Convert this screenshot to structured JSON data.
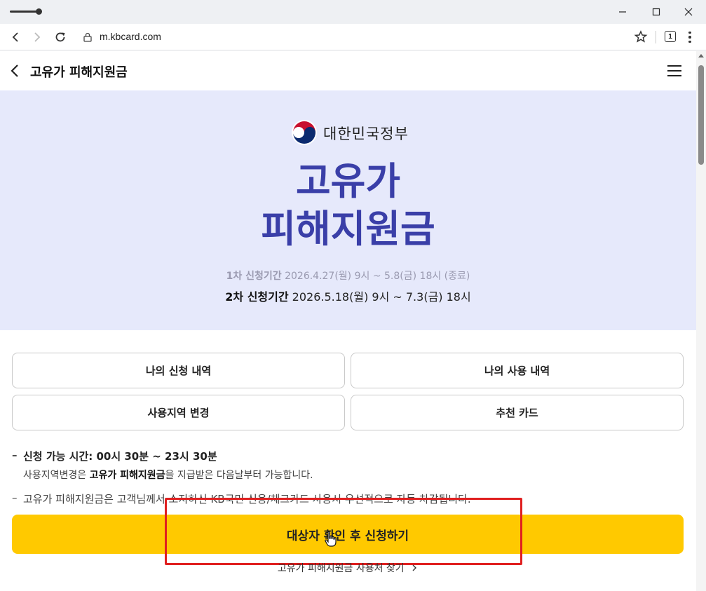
{
  "browser": {
    "url": "m.kbcard.com",
    "tab_count": "1"
  },
  "header": {
    "title": "고유가 피해지원금"
  },
  "hero": {
    "gov_name": "대한민국정부",
    "title_line1": "고유가",
    "title_line2": "피해지원금",
    "period1_label": "1차 신청기간",
    "period1_value": " 2026.4.27(월) 9시 ~ 5.8(금) 18시 (종료)",
    "period2_label": "2차 신청기간",
    "period2_value": " 2026.5.18(월) 9시 ~ 7.3(금) 18시"
  },
  "buttons": {
    "my_application": "나의 신청 내역",
    "my_usage": "나의 사용 내역",
    "change_region": "사용지역 변경",
    "recommended_card": "추천 카드"
  },
  "notes": {
    "hours": "신청 가능 시간: 00시 30분 ~ 23시 30분",
    "region_sub_pre": "사용지역변경은 ",
    "region_sub_bold": "고유가 피해지원금",
    "region_sub_post": "을 지급받은 다음날부터 가능합니다.",
    "auto_deduct": "고유가 피해지원금은 고객님께서 소지하신 KB국민 신용/체크카드 사용시 우선적으로 자동 차감됩니다."
  },
  "cta": {
    "label": "대상자 확인 후 신청하기"
  },
  "footer_link": {
    "label": "고유가 피해지원금 사용처 찾기"
  },
  "icons": {
    "back": "back-arrow-icon",
    "menu": "hamburger-icon",
    "gov_logo": "taegeuk-logo-icon",
    "chevron": "chevron-right-icon"
  },
  "colors": {
    "hero_bg": "#e6e9fb",
    "hero_title": "#3a3fa8",
    "cta_bg": "#ffc900",
    "highlight": "#e02020"
  }
}
